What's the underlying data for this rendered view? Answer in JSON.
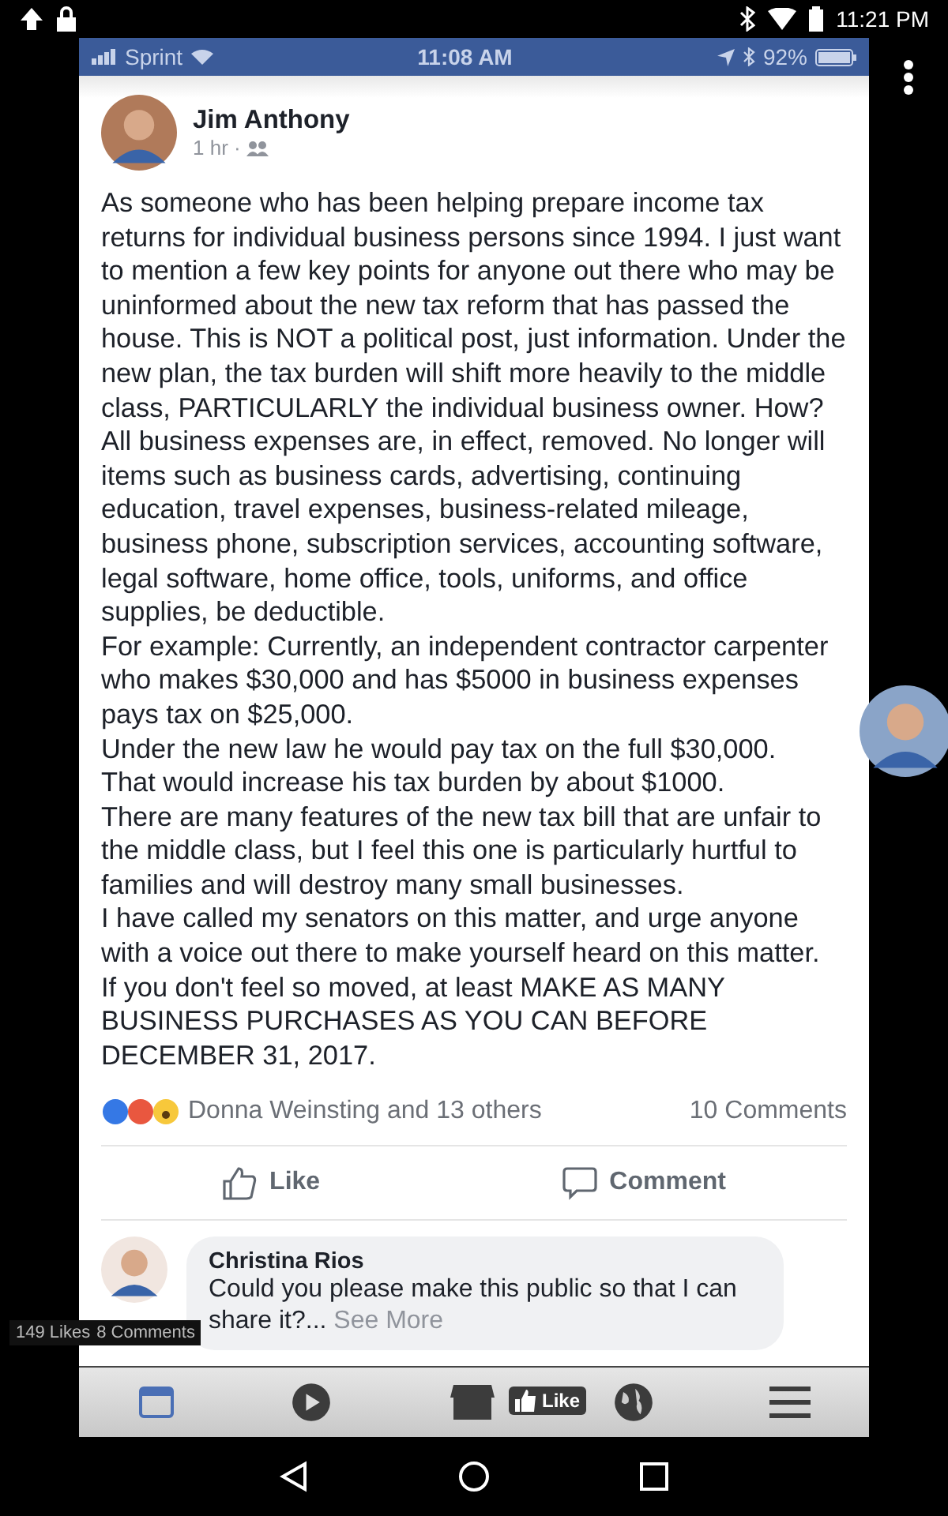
{
  "android_status": {
    "time": "11:21 PM"
  },
  "phone_status": {
    "carrier": "Sprint",
    "time": "11:08 AM",
    "battery": "92%"
  },
  "post": {
    "author": "Jim Anthony",
    "time": "1 hr ·",
    "paragraphs": [
      "As someone who has been helping prepare income tax returns for  individual business persons since 1994. I just want to mention a few key points for anyone out there who may be uninformed about the new tax reform that has passed the house. This is NOT a political post, just information. Under the new plan, the tax burden will shift more heavily to the middle class, PARTICULARLY the individual business owner. How? All business expenses are, in effect, removed. No longer will items such as business cards, advertising, continuing education, travel expenses, business-related mileage, business phone, subscription services, accounting software, legal software, home office, tools, uniforms, and office supplies, be deductible.",
      "For example: Currently, an independent contractor carpenter who makes $30,000 and has $5000 in business expenses pays tax on $25,000.",
      "Under the new law he would pay tax on the full $30,000.",
      "That would increase his tax burden by about $1000.",
      "There are many features of the new tax bill that are unfair to the middle class, but  I feel this one is particularly hurtful to families and will destroy many small businesses.",
      "I have called my senators on this matter, and urge anyone with a voice out there to make yourself heard on this matter.",
      "If you don't feel so moved, at least MAKE AS MANY BUSINESS PURCHASES AS YOU CAN BEFORE DECEMBER 31, 2017."
    ],
    "reactions": "Donna Weinsting and 13 others",
    "comments_count": "10 Comments",
    "actions": [
      "Like",
      "Comment"
    ]
  },
  "comment": {
    "author": "Christina Rios",
    "text": "Could you please make this public so that I can share it?...",
    "see_more": "See More"
  },
  "overlay": {
    "likes": "149 Likes",
    "comments": "8 Comments",
    "like_button": "Like"
  },
  "tabs": [
    {
      "kind": "feed",
      "selected": true
    },
    {
      "kind": "video",
      "selected": false
    },
    {
      "kind": "store",
      "selected": false
    },
    {
      "kind": "globe",
      "selected": false
    },
    {
      "kind": "menu",
      "selected": false
    }
  ]
}
